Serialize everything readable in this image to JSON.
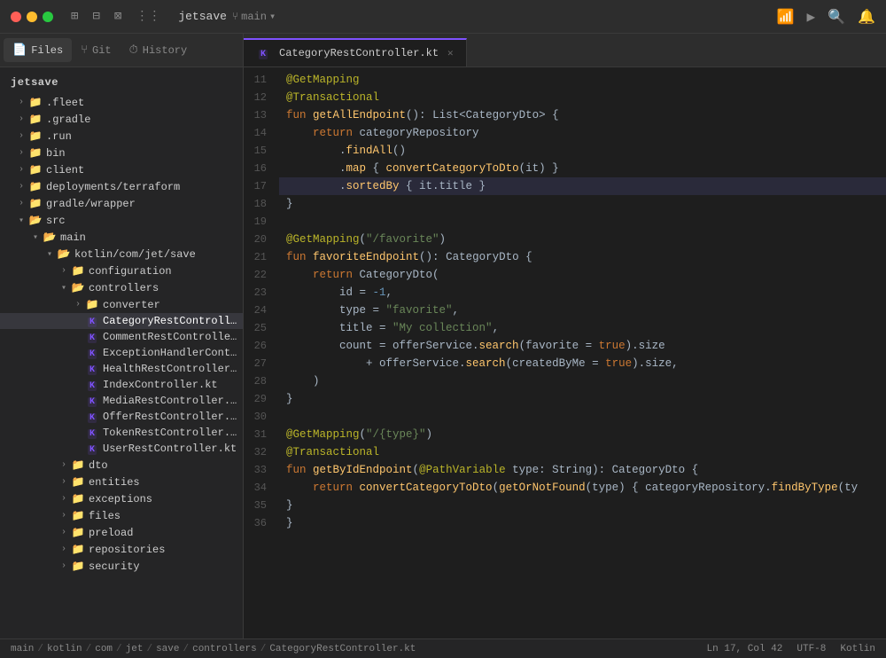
{
  "titlebar": {
    "project": "jetsave",
    "branch": "main",
    "branch_icon": "⎇",
    "dropdown_icon": "▾"
  },
  "sidebar": {
    "tabs": [
      {
        "id": "files",
        "label": "Files",
        "icon": "📄",
        "active": true
      },
      {
        "id": "git",
        "label": "Git",
        "icon": "⑂",
        "active": false
      },
      {
        "id": "history",
        "label": "History",
        "icon": "⏱",
        "active": false
      }
    ],
    "project_root": "jetsave",
    "tree": [
      {
        "depth": 1,
        "type": "folder",
        "label": ".fleet",
        "expanded": false
      },
      {
        "depth": 1,
        "type": "folder",
        "label": ".gradle",
        "expanded": false
      },
      {
        "depth": 1,
        "type": "folder",
        "label": ".run",
        "expanded": false
      },
      {
        "depth": 1,
        "type": "folder",
        "label": "bin",
        "expanded": false
      },
      {
        "depth": 1,
        "type": "folder",
        "label": "client",
        "expanded": false
      },
      {
        "depth": 1,
        "type": "folder",
        "label": "deployments/terraform",
        "expanded": false
      },
      {
        "depth": 1,
        "type": "folder",
        "label": "gradle/wrapper",
        "expanded": false
      },
      {
        "depth": 1,
        "type": "folder",
        "label": "src",
        "expanded": true
      },
      {
        "depth": 2,
        "type": "folder",
        "label": "main",
        "expanded": true
      },
      {
        "depth": 3,
        "type": "folder",
        "label": "kotlin/com/jet/save",
        "expanded": true
      },
      {
        "depth": 4,
        "type": "folder",
        "label": "configuration",
        "expanded": false
      },
      {
        "depth": 4,
        "type": "folder",
        "label": "controllers",
        "expanded": true
      },
      {
        "depth": 5,
        "type": "folder",
        "label": "converter",
        "expanded": false
      },
      {
        "depth": 5,
        "type": "kotlin",
        "label": "CategoryRestController.kt",
        "selected": true
      },
      {
        "depth": 5,
        "type": "kotlin",
        "label": "CommentRestController.kt"
      },
      {
        "depth": 5,
        "type": "kotlin",
        "label": "ExceptionHandlerControlle..."
      },
      {
        "depth": 5,
        "type": "kotlin",
        "label": "HealthRestController.kt"
      },
      {
        "depth": 5,
        "type": "kotlin",
        "label": "IndexController.kt"
      },
      {
        "depth": 5,
        "type": "kotlin",
        "label": "MediaRestController.kt"
      },
      {
        "depth": 5,
        "type": "kotlin",
        "label": "OfferRestController.kt"
      },
      {
        "depth": 5,
        "type": "kotlin",
        "label": "TokenRestController.kt"
      },
      {
        "depth": 5,
        "type": "kotlin",
        "label": "UserRestController.kt"
      },
      {
        "depth": 4,
        "type": "folder",
        "label": "dto",
        "expanded": false
      },
      {
        "depth": 4,
        "type": "folder",
        "label": "entities",
        "expanded": false
      },
      {
        "depth": 4,
        "type": "folder",
        "label": "exceptions",
        "expanded": false
      },
      {
        "depth": 4,
        "type": "folder",
        "label": "files",
        "expanded": false
      },
      {
        "depth": 4,
        "type": "folder",
        "label": "preload",
        "expanded": false
      },
      {
        "depth": 4,
        "type": "folder",
        "label": "repositories",
        "expanded": false
      },
      {
        "depth": 4,
        "type": "folder",
        "label": "security",
        "expanded": false
      }
    ]
  },
  "editor": {
    "tab_label": "CategoryRestController.kt",
    "tab_icon": "K"
  },
  "statusbar": {
    "breadcrumb": [
      "main",
      "kotlin",
      "com",
      "jet",
      "save",
      "controllers",
      "CategoryRestController.kt"
    ],
    "sep": "/",
    "position": "Ln 17, Col 42",
    "encoding": "UTF-8",
    "language": "Kotlin"
  }
}
